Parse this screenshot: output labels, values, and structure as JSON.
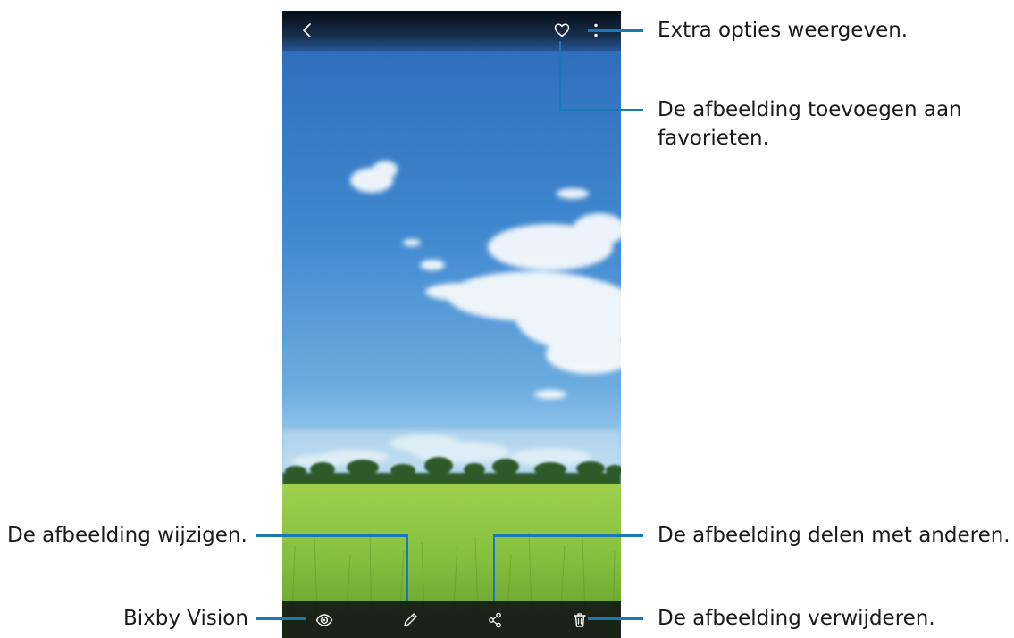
{
  "viewer": {
    "top_bar": {
      "back": {
        "icon": "chevron-left-icon"
      },
      "favorite": {
        "icon": "heart-outline-icon"
      },
      "more": {
        "icon": "more-vertical-icon"
      }
    },
    "bottom_bar": {
      "bixby_vision": {
        "icon": "eye-icon"
      },
      "edit": {
        "icon": "pencil-icon"
      },
      "share": {
        "icon": "share-icon"
      },
      "delete": {
        "icon": "trash-icon"
      }
    }
  },
  "callouts": {
    "more_options": "Extra opties weergeven.",
    "favorites_line1": "De afbeelding toevoegen aan",
    "favorites_line2": "favorieten.",
    "edit": "De afbeelding wijzigen.",
    "share": "De afbeelding delen met anderen.",
    "bixby": "Bixby Vision",
    "delete": "De afbeelding verwijderen."
  },
  "colors": {
    "callout_line": "#1a78b4",
    "sky_top": "#2a69b5",
    "field_green": "#7fba3c"
  }
}
